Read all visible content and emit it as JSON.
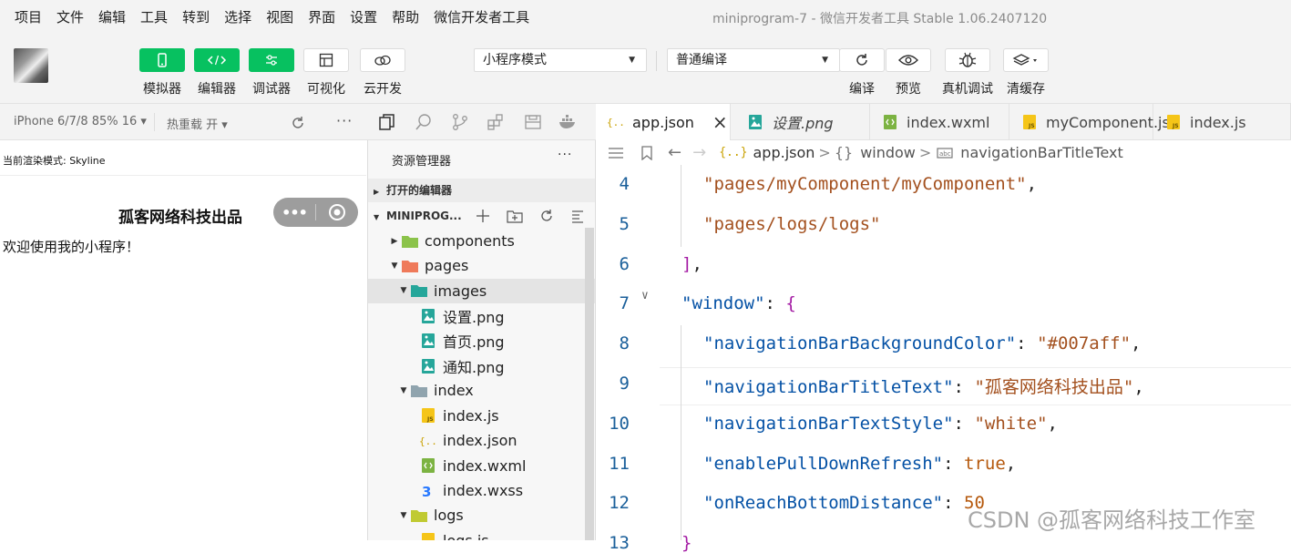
{
  "menubar": {
    "items": [
      "项目",
      "文件",
      "编辑",
      "工具",
      "转到",
      "选择",
      "视图",
      "界面",
      "设置",
      "帮助",
      "微信开发者工具"
    ],
    "window_title": "miniprogram-7 - 微信开发者工具 Stable 1.06.2407120"
  },
  "toolbar": {
    "left_buttons": [
      {
        "label": "模拟器",
        "icon": "phone-icon"
      },
      {
        "label": "编辑器",
        "icon": "code-icon"
      },
      {
        "label": "调试器",
        "icon": "sliders-icon"
      },
      {
        "label": "可视化",
        "icon": "layout-icon"
      },
      {
        "label": "云开发",
        "icon": "cloud-icon"
      }
    ],
    "mode_select": "小程序模式",
    "compile_select": "普通编译",
    "right_buttons": [
      {
        "label": "编译",
        "icon": "refresh-icon"
      },
      {
        "label": "预览",
        "icon": "eye-icon"
      },
      {
        "label": "真机调试",
        "icon": "bug-icon"
      },
      {
        "label": "清缓存",
        "icon": "layers-icon"
      }
    ]
  },
  "simulator": {
    "device": "iPhone 6/7/8 85% 16 ▾",
    "hot_reload": "热重载 开 ▾",
    "render_mode": "当前渲染模式: Skyline",
    "nav_title": "孤客网络科技出品",
    "content": "欢迎使用我的小程序！"
  },
  "explorer": {
    "title": "资源管理器",
    "open_editors": "打开的编辑器",
    "project": "MINIPROG...",
    "tree": [
      {
        "name": "components",
        "depth": 0,
        "arrow": "▶",
        "type": "folder-green"
      },
      {
        "name": "pages",
        "depth": 0,
        "arrow": "▼",
        "type": "folder-orange"
      },
      {
        "name": "images",
        "depth": 1,
        "arrow": "▼",
        "type": "folder-teal",
        "selected": true
      },
      {
        "name": "设置.png",
        "depth": 2,
        "arrow": "",
        "type": "image"
      },
      {
        "name": "首页.png",
        "depth": 2,
        "arrow": "",
        "type": "image"
      },
      {
        "name": "通知.png",
        "depth": 2,
        "arrow": "",
        "type": "image"
      },
      {
        "name": "index",
        "depth": 1,
        "arrow": "▼",
        "type": "folder-grey"
      },
      {
        "name": "index.js",
        "depth": 2,
        "arrow": "",
        "type": "js"
      },
      {
        "name": "index.json",
        "depth": 2,
        "arrow": "",
        "type": "json"
      },
      {
        "name": "index.wxml",
        "depth": 2,
        "arrow": "",
        "type": "wxml"
      },
      {
        "name": "index.wxss",
        "depth": 2,
        "arrow": "",
        "type": "wxss"
      },
      {
        "name": "logs",
        "depth": 1,
        "arrow": "▼",
        "type": "folder-yellow"
      },
      {
        "name": "logs.js",
        "depth": 2,
        "arrow": "",
        "type": "js"
      }
    ]
  },
  "tabs": [
    {
      "label": "app.json",
      "icon": "json",
      "active": true,
      "close": "×"
    },
    {
      "label": "设置.png",
      "icon": "image",
      "active": false,
      "italic": true
    },
    {
      "label": "index.wxml",
      "icon": "wxml",
      "active": false
    },
    {
      "label": "myComponent.js",
      "icon": "js",
      "active": false
    },
    {
      "label": "index.js",
      "icon": "js",
      "active": false
    }
  ],
  "breadcrumb": {
    "file": "app.json",
    "sep": ">",
    "obj_icon": "{}",
    "key1": "window",
    "key2": "navigationBarTitleText"
  },
  "editor": {
    "lines": [
      {
        "n": "4",
        "parts": [
          [
            "s",
            "\"pages/myComponent/myComponent\""
          ],
          [
            "p",
            ","
          ]
        ]
      },
      {
        "n": "5",
        "parts": [
          [
            "s",
            "\"pages/logs/logs\""
          ]
        ]
      },
      {
        "n": "6",
        "parts": [
          [
            "brk",
            "]"
          ],
          [
            "p",
            ","
          ]
        ]
      },
      {
        "n": "7",
        "parts": [
          [
            "k",
            "\"window\""
          ],
          [
            "p",
            ": "
          ],
          [
            "brk",
            "{"
          ]
        ]
      },
      {
        "n": "8",
        "parts": [
          [
            "k",
            "\"navigationBarBackgroundColor\""
          ],
          [
            "p",
            ": "
          ],
          [
            "s",
            "\"#007aff\""
          ],
          [
            "p",
            ","
          ]
        ]
      },
      {
        "n": "9",
        "parts": [
          [
            "k",
            "\"navigationBarTitleText\""
          ],
          [
            "p",
            ": "
          ],
          [
            "s",
            "\"孤客网络科技出品\""
          ],
          [
            "p",
            ","
          ]
        ]
      },
      {
        "n": "10",
        "parts": [
          [
            "k",
            "\"navigationBarTextStyle\""
          ],
          [
            "p",
            ": "
          ],
          [
            "s",
            "\"white\""
          ],
          [
            "p",
            ","
          ]
        ]
      },
      {
        "n": "11",
        "parts": [
          [
            "k",
            "\"enablePullDownRefresh\""
          ],
          [
            "p",
            ": "
          ],
          [
            "b",
            "true"
          ],
          [
            "p",
            ","
          ]
        ]
      },
      {
        "n": "12",
        "parts": [
          [
            "k",
            "\"onReachBottomDistance\""
          ],
          [
            "p",
            ": "
          ],
          [
            "b",
            "50"
          ]
        ]
      },
      {
        "n": "13",
        "parts": [
          [
            "brk",
            "}"
          ]
        ]
      }
    ]
  },
  "watermark": "CSDN @孤客网络科技工作室",
  "colors": {
    "accent": "#07c160",
    "key": "#0451a5",
    "string": "#a3501e",
    "bracket": "#a31aa3",
    "line_number": "#1a5f9a"
  }
}
